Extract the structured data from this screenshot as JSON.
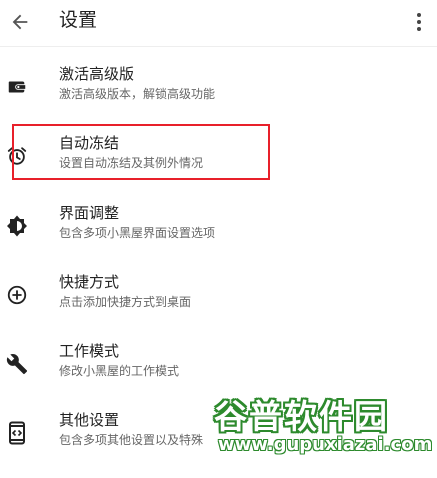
{
  "appbar": {
    "title": "设置",
    "back_icon": "arrow-left-icon",
    "more_icon": "more-vertical-icon"
  },
  "items": [
    {
      "label": "激活高级版",
      "sub": "激活高级版本，解锁高级功能",
      "icon": "wallet-icon"
    },
    {
      "label": "自动冻结",
      "sub": "设置自动冻结及其例外情况",
      "icon": "alarm-icon"
    },
    {
      "label": "界面调整",
      "sub": "包含多项小黑屋界面设置选项",
      "icon": "brightness-icon"
    },
    {
      "label": "快捷方式",
      "sub": "点击添加快捷方式到桌面",
      "icon": "add-circle-icon"
    },
    {
      "label": "工作模式",
      "sub": "修改小黑屋的工作模式",
      "icon": "wrench-icon"
    },
    {
      "label": "其他设置",
      "sub": "包含多项其他设置以及特殊",
      "icon": "code-phone-icon"
    }
  ],
  "watermark": {
    "title": "谷普软件园",
    "url": "www.gupuxiazai.com",
    "color": "#2d8a2d"
  },
  "highlight_color": "#e8202a"
}
